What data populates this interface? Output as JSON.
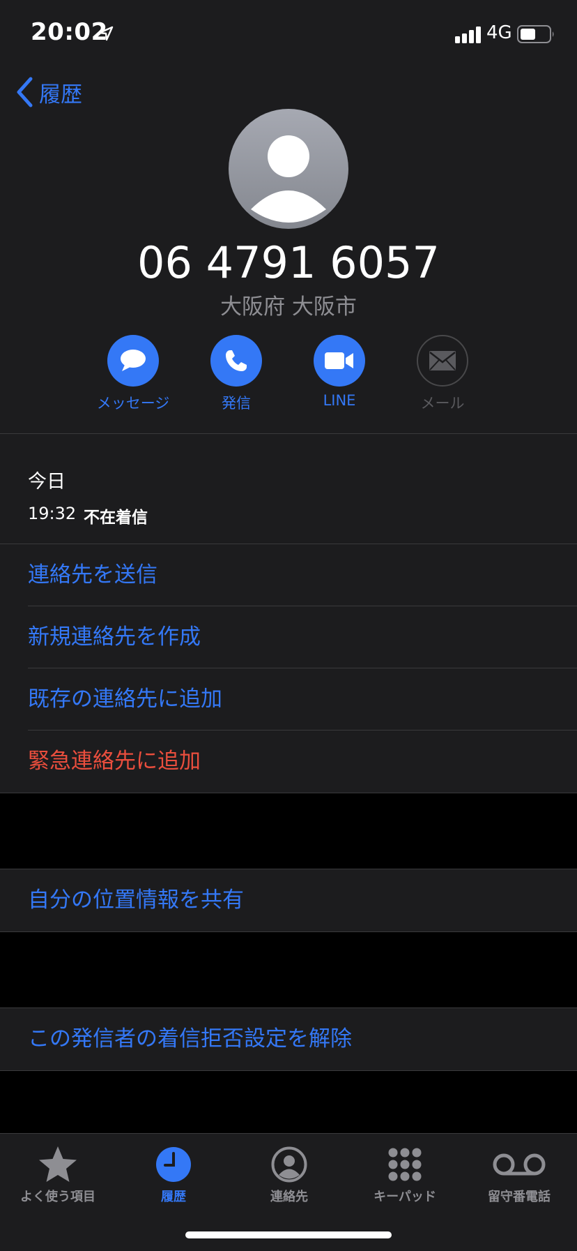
{
  "status_bar": {
    "time": "20:02",
    "network": "4G"
  },
  "nav": {
    "back_label": "履歴"
  },
  "caller": {
    "number": "06 4791 6057",
    "region": "大阪府 大阪市"
  },
  "actions": [
    {
      "label": "メッセージ",
      "icon": "message-bubble-icon",
      "enabled": true
    },
    {
      "label": "発信",
      "icon": "phone-icon",
      "enabled": true
    },
    {
      "label": "LINE",
      "icon": "video-icon",
      "enabled": true
    },
    {
      "label": "メール",
      "icon": "mail-icon",
      "enabled": false
    }
  ],
  "history": {
    "day": "今日",
    "time": "19:32",
    "type": "不在着信"
  },
  "options_group1": [
    "連絡先を送信",
    "新規連絡先を作成",
    "既存の連絡先に追加",
    "緊急連絡先に追加"
  ],
  "options_group2": [
    "自分の位置情報を共有"
  ],
  "options_group3": [
    "この発信者の着信拒否設定を解除"
  ],
  "tabbar": {
    "tabs": [
      {
        "label": "よく使う項目",
        "icon": "star-icon"
      },
      {
        "label": "履歴",
        "icon": "clock-icon",
        "active": true
      },
      {
        "label": "連絡先",
        "icon": "contacts-icon"
      },
      {
        "label": "キーパッド",
        "icon": "keypad-icon"
      },
      {
        "label": "留守番電話",
        "icon": "voicemail-icon"
      }
    ]
  },
  "colors": {
    "accent": "#3478f6",
    "destructive": "#ea4e3d",
    "background": "#000000",
    "cell": "#1c1c1e"
  }
}
